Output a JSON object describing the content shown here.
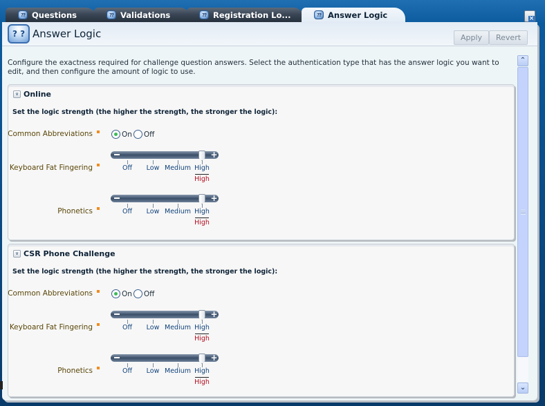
{
  "tabs": [
    {
      "label": "Questions",
      "icon": "question-cube-icon",
      "active": false
    },
    {
      "label": "Validations",
      "icon": "question-cube-icon",
      "active": false
    },
    {
      "label": "Registration Lo...",
      "icon": "question-cube-icon",
      "active": false
    },
    {
      "label": "Answer Logic",
      "icon": "question-cube-icon",
      "active": true
    }
  ],
  "page": {
    "title": "Answer Logic",
    "icon_text": "? ?",
    "apply_label": "Apply",
    "revert_label": "Revert",
    "intro": "Configure the exactness required for challenge question answers. Select the authentication type that has the answer logic you want to edit, and then configure the amount of logic to use."
  },
  "slider_levels": [
    "Off",
    "Low",
    "Medium",
    "High"
  ],
  "sections": [
    {
      "title": "Online",
      "subtitle": "Set the logic strength (the higher the strength, the stronger the logic):",
      "abbrev": {
        "label": "Common Abbreviations",
        "on_label": "On",
        "off_label": "Off",
        "value": "On"
      },
      "fat_finger": {
        "label": "Keyboard Fat Fingering",
        "value": "High",
        "level_index": 3
      },
      "phonetics": {
        "label": "Phonetics",
        "value": "High",
        "level_index": 3
      }
    },
    {
      "title": "CSR Phone Challenge",
      "subtitle": "Set the logic strength (the higher the strength, the stronger the logic):",
      "abbrev": {
        "label": "Common Abbreviations",
        "on_label": "On",
        "off_label": "Off",
        "value": "On"
      },
      "fat_finger": {
        "label": "Keyboard Fat Fingering",
        "value": "High",
        "level_index": 3
      },
      "phonetics": {
        "label": "Phonetics",
        "value": "High",
        "level_index": 3
      }
    }
  ],
  "colors": {
    "required_marker": "#f08c1d",
    "selected_value": "#b10d1f",
    "label": "#5a4608"
  }
}
